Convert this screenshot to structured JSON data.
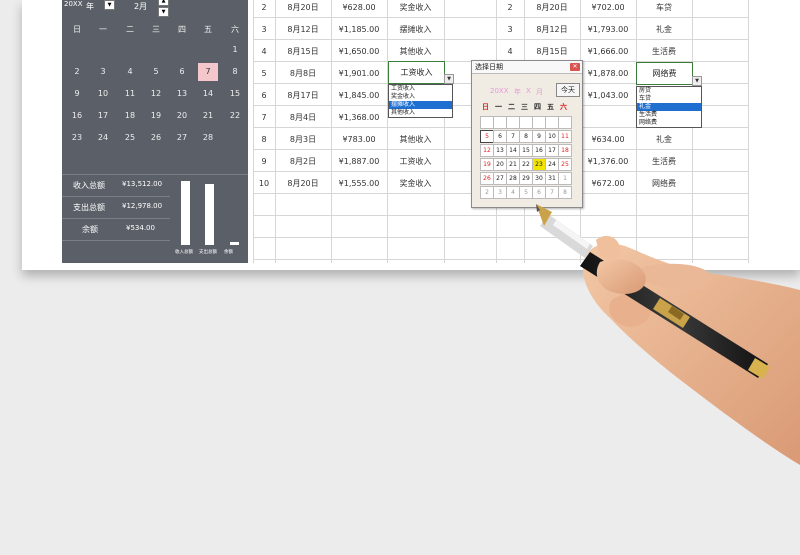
{
  "panel": {
    "year": "20XX",
    "year_unit": "年",
    "month": "2月",
    "weekdays": [
      "日",
      "一",
      "二",
      "三",
      "四",
      "五",
      "六"
    ],
    "days": [
      [
        "",
        "",
        "",
        "",
        "",
        "",
        "1"
      ],
      [
        "2",
        "3",
        "4",
        "5",
        "6",
        "7",
        "8"
      ],
      [
        "9",
        "10",
        "11",
        "12",
        "13",
        "14",
        "15"
      ],
      [
        "16",
        "17",
        "18",
        "19",
        "20",
        "21",
        "22"
      ],
      [
        "23",
        "24",
        "25",
        "26",
        "27",
        "28",
        ""
      ]
    ],
    "selected_day": "7",
    "income_label": "收入总额",
    "income_value": "¥13,512.00",
    "expense_label": "支出总额",
    "expense_value": "¥12,978.00",
    "balance_label": "余额",
    "balance_value": "¥534.00",
    "bars": [
      {
        "label": "收入总额",
        "value": 13512
      },
      {
        "label": "支出总额",
        "value": 12978
      },
      {
        "label": "余额",
        "value": 534
      }
    ]
  },
  "income_rows": [
    {
      "no": "2",
      "date": "8月20日",
      "amount": "¥628.00",
      "type": "奖金收入"
    },
    {
      "no": "3",
      "date": "8月12日",
      "amount": "¥1,185.00",
      "type": "摆摊收入"
    },
    {
      "no": "4",
      "date": "8月15日",
      "amount": "¥1,650.00",
      "type": "其他收入"
    },
    {
      "no": "5",
      "date": "8月8日",
      "amount": "¥1,901.00",
      "type": "工资收入"
    },
    {
      "no": "6",
      "date": "8月17日",
      "amount": "¥1,845.00",
      "type": ""
    },
    {
      "no": "7",
      "date": "8月4日",
      "amount": "¥1,368.00",
      "type": ""
    },
    {
      "no": "8",
      "date": "8月3日",
      "amount": "¥783.00",
      "type": "其他收入"
    },
    {
      "no": "9",
      "date": "8月2日",
      "amount": "¥1,887.00",
      "type": "工资收入"
    },
    {
      "no": "10",
      "date": "8月20日",
      "amount": "¥1,555.00",
      "type": "奖金收入"
    }
  ],
  "expense_rows": [
    {
      "no": "2",
      "date": "8月20日",
      "amount": "¥702.00",
      "type": "车贷"
    },
    {
      "no": "3",
      "date": "8月12日",
      "amount": "¥1,793.00",
      "type": "礼金"
    },
    {
      "no": "4",
      "date": "8月15日",
      "amount": "¥1,666.00",
      "type": "生活费"
    },
    {
      "no": "",
      "date": "",
      "amount": "¥1,878.00",
      "type": "网络费"
    },
    {
      "no": "",
      "date": "",
      "amount": "¥1,043.00",
      "type": ""
    },
    {
      "no": "",
      "date": "",
      "amount": "",
      "type": "礼金"
    },
    {
      "no": "",
      "date": "",
      "amount": "¥634.00",
      "type": "礼金"
    },
    {
      "no": "",
      "date": "",
      "amount": "¥1,376.00",
      "type": "生活费"
    },
    {
      "no": "",
      "date": "",
      "amount": "¥672.00",
      "type": "网络费"
    }
  ],
  "income_dropdown": [
    "工资收入",
    "奖金收入",
    "摆摊收入",
    "其他收入"
  ],
  "income_dropdown_selected": 2,
  "expense_dropdown": [
    "房贷",
    "车贷",
    "礼金",
    "生活费",
    "网络费"
  ],
  "expense_dropdown_selected": 2,
  "date_picker": {
    "title": "选择日期",
    "year": "20XX",
    "year_unit": "年",
    "month": "X",
    "month_unit": "月",
    "today_button": "今天",
    "weekdays": [
      "日",
      "一",
      "二",
      "三",
      "四",
      "五",
      "六"
    ],
    "weeks": [
      [
        "",
        "",
        "",
        "",
        "",
        "",
        ""
      ],
      [
        "5",
        "6",
        "7",
        "8",
        "9",
        "10",
        "11"
      ],
      [
        "12",
        "13",
        "14",
        "15",
        "16",
        "17",
        "18"
      ],
      [
        "19",
        "20",
        "21",
        "22",
        "23",
        "24",
        "25"
      ],
      [
        "26",
        "27",
        "28",
        "29",
        "30",
        "31",
        "1"
      ],
      [
        "2",
        "3",
        "4",
        "5",
        "6",
        "7",
        "8"
      ]
    ],
    "today_day": "23",
    "current_day": "5"
  }
}
